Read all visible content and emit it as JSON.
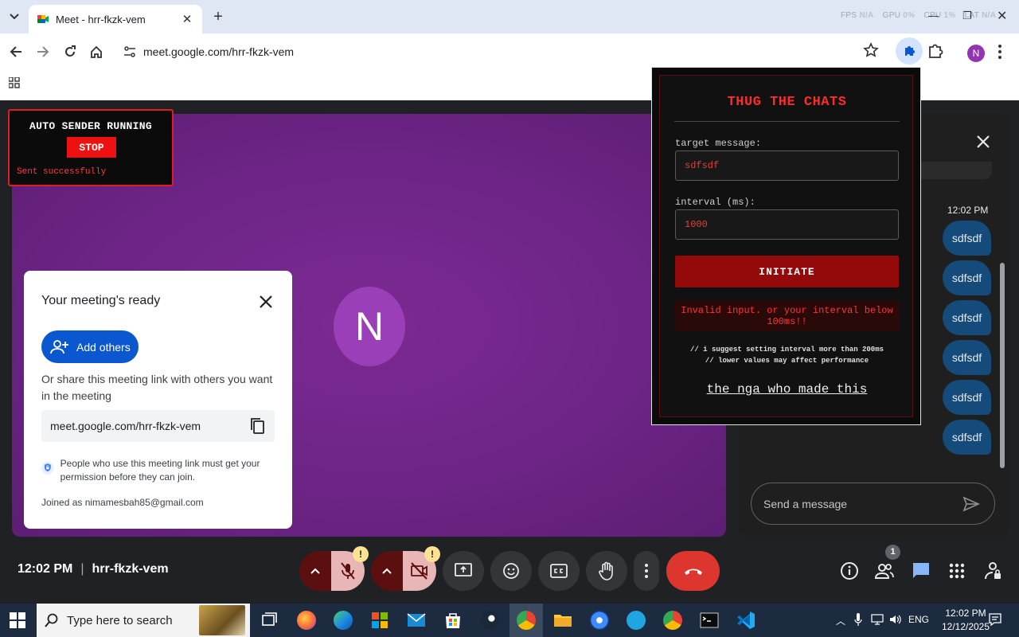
{
  "browser": {
    "tab_title": "Meet - hrr-fkzk-vem",
    "url": "meet.google.com/hrr-fkzk-vem",
    "profile_initial": "N",
    "perf_overlay": {
      "fps": "N/A",
      "gpu": "0%",
      "cpu": "1%",
      "lat": "N/A"
    }
  },
  "auto_sender": {
    "title": "AUTO SENDER RUNNING",
    "stop_label": "STOP",
    "status": "Sent successfully"
  },
  "stage": {
    "avatar_initial": "N"
  },
  "meeting_card": {
    "title": "Your meeting's ready",
    "add_others_label": "Add others",
    "share_text": "Or share this meeting link with others you want in the meeting",
    "link": "meet.google.com/hrr-fkzk-vem",
    "permission_text": "People who use this meeting link must get your permission before they can join.",
    "joined_as": "Joined as nimamesbah85@gmail.com"
  },
  "extension": {
    "title": "THUG THE CHATS",
    "target_label": "target message:",
    "target_value": "sdfsdf",
    "interval_label": "interval (ms):",
    "interval_value": "1000",
    "initiate_label": "INITIATE",
    "error_line1": "Invalid input. or your interval below",
    "error_line2": "100ms!!",
    "note_line1": "// i suggest setting interval more than 200ms",
    "note_line2": "// lower values may affect performance",
    "credit_link": "the nga who made this"
  },
  "chat": {
    "timestamp": "12:02 PM",
    "messages": [
      "sdfsdf",
      "sdfsdf",
      "sdfsdf",
      "sdfsdf",
      "sdfsdf",
      "sdfsdf"
    ],
    "input_placeholder": "Send a message"
  },
  "bottom_bar": {
    "time": "12:02 PM",
    "meeting_code": "hrr-fkzk-vem",
    "people_count": "1",
    "warning_mark": "!"
  },
  "taskbar": {
    "search_placeholder": "Type here to search",
    "language": "ENG",
    "clock_time": "12:02 PM",
    "clock_date": "12/12/2025"
  },
  "colors": {
    "meet_background": "#202124",
    "stage_purple": "#6d2486",
    "accent_blue": "#0b57d0",
    "leave_red": "#dc362e",
    "extension_red": "#ff2a2a",
    "chat_bubble": "#144b7a"
  }
}
